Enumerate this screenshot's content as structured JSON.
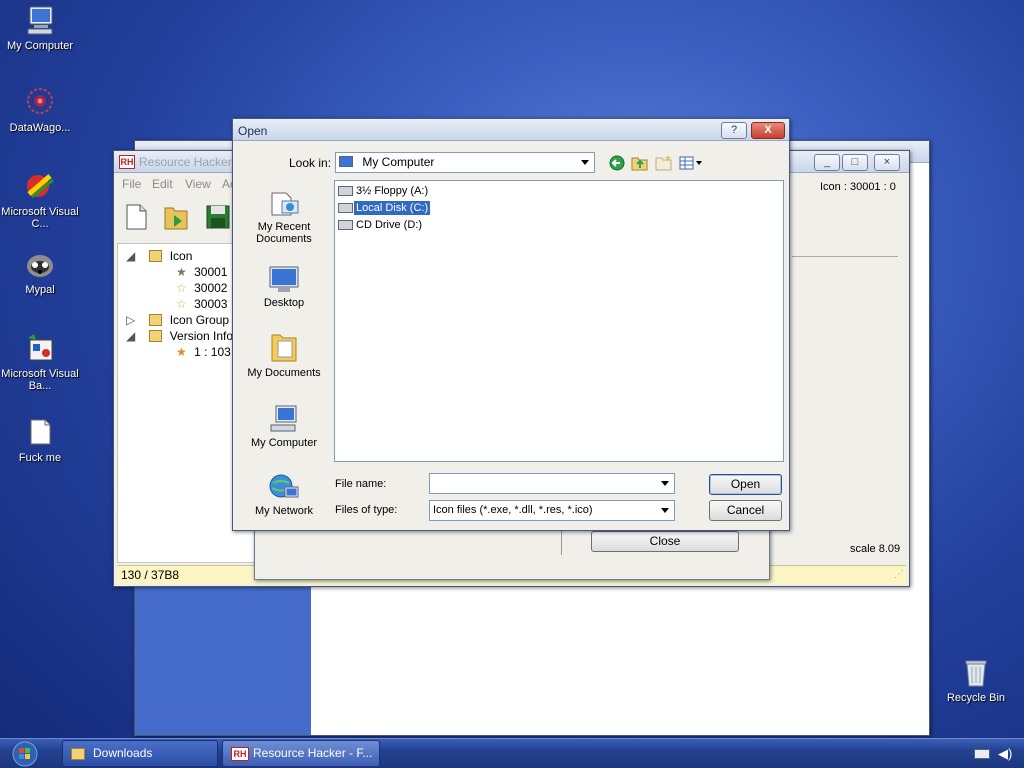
{
  "desktop": {
    "icons": [
      {
        "label": "My Computer",
        "icon": "computer-icon"
      },
      {
        "label": "DataWago...",
        "icon": "datawago-icon"
      },
      {
        "label": "Microsoft Visual C...",
        "icon": "visual-c-icon"
      },
      {
        "label": "Mypal",
        "icon": "mypal-icon"
      },
      {
        "label": "Microsoft Visual Ba...",
        "icon": "visual-basic-icon"
      },
      {
        "label": "Fuck me",
        "icon": "document-icon"
      },
      {
        "label": "Recycle Bin",
        "icon": "recycle-bin-icon"
      }
    ]
  },
  "resource_hacker": {
    "title": "Resource Hacker",
    "menu": [
      "File",
      "Edit",
      "View",
      "Ac"
    ],
    "tree": [
      {
        "label": "Icon"
      },
      {
        "label": "30001"
      },
      {
        "label": "30002"
      },
      {
        "label": "30003"
      },
      {
        "label": "Icon Group"
      },
      {
        "label": "Version Info"
      },
      {
        "label": "1 : 103"
      }
    ],
    "right_label": "Icon : 30001 : 0",
    "status_left": "130 / 37B8",
    "scale": "scale 8.09",
    "close_label": "Close"
  },
  "open_dialog": {
    "title": "Open",
    "help_label": "?",
    "close_label": "X",
    "look_in_label": "Look in:",
    "look_in_value": "My Computer",
    "places": [
      {
        "label": "My Recent Documents",
        "icon": "recent-documents-icon"
      },
      {
        "label": "Desktop",
        "icon": "desktop-icon"
      },
      {
        "label": "My Documents",
        "icon": "my-documents-icon"
      },
      {
        "label": "My Computer",
        "icon": "computer-icon"
      },
      {
        "label": "My Network",
        "icon": "network-icon"
      }
    ],
    "drives": [
      {
        "label": "3½ Floppy (A:)",
        "icon": "floppy-drive-icon",
        "selected": false
      },
      {
        "label": "Local Disk (C:)",
        "icon": "hard-disk-icon",
        "selected": true
      },
      {
        "label": "CD Drive (D:)",
        "icon": "cd-drive-icon",
        "selected": false
      }
    ],
    "file_name_label": "File name:",
    "file_name_value": "",
    "files_of_type_label": "Files of type:",
    "files_of_type_value": "Icon files (*.exe, *.dll, *.res, *.ico)",
    "open_button": "Open",
    "cancel_button": "Cancel"
  },
  "taskbar": {
    "items": [
      {
        "label": "Downloads",
        "icon": "folder-icon"
      },
      {
        "label": "Resource Hacker - F...",
        "icon": "resource-hacker-icon"
      }
    ]
  },
  "colors": {
    "selection": "#316ac5",
    "status_bar": "#fbf6c4",
    "taskbar": "#23418f"
  }
}
